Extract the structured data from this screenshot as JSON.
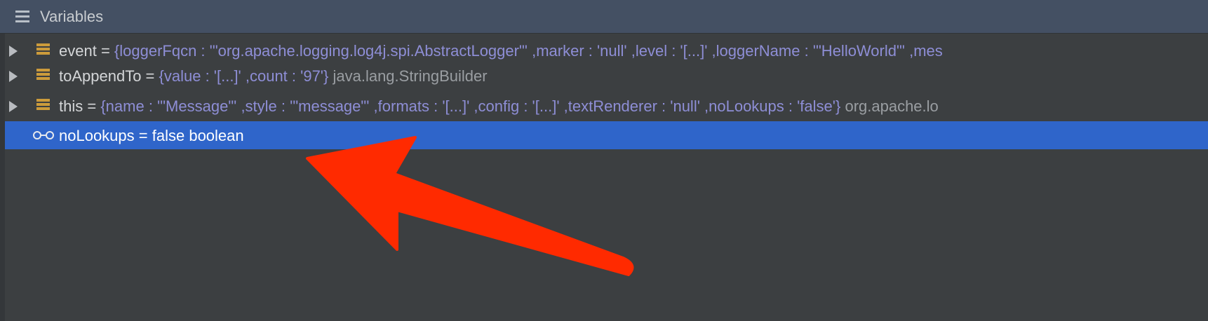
{
  "header": {
    "title": "Variables",
    "icon": "list-icon"
  },
  "variables": [
    {
      "name": "event",
      "eq": " = ",
      "value": "{loggerFqcn : '\"org.apache.logging.log4j.spi.AbstractLogger\"' ,marker : 'null' ,level : '[...]' ,loggerName : '\"HelloWorld\"' ,mes",
      "type": "",
      "icon": "field-icon",
      "expandable": true
    },
    {
      "name": "toAppendTo",
      "eq": " = ",
      "value": "{value : '[...]' ,count : '97'}",
      "type": " java.lang.StringBuilder",
      "icon": "field-icon",
      "expandable": true
    },
    {
      "name": "this",
      "eq": " = ",
      "value": "{name : '\"Message\"' ,style : '\"message\"' ,formats : '[...]' ,config : '[...]' ,textRenderer : 'null' ,noLookups : 'false'}",
      "type": " org.apache.lo",
      "icon": "field-icon",
      "expandable": true
    },
    {
      "name": "noLookups",
      "eq": " = ",
      "value": "false",
      "type": " boolean",
      "icon": "watch-icon",
      "expandable": false,
      "selected": true
    }
  ],
  "colors": {
    "header_bg": "#445063",
    "panel_bg": "#3c3f41",
    "selection": "#2f65ca",
    "value_text": "#8e8ed6",
    "field_icon": "#cc9b3b",
    "annotation_arrow": "#ff2a00"
  },
  "annotation": {
    "shape": "arrow",
    "color": "#ff2a00",
    "points_to": "noLookups"
  }
}
